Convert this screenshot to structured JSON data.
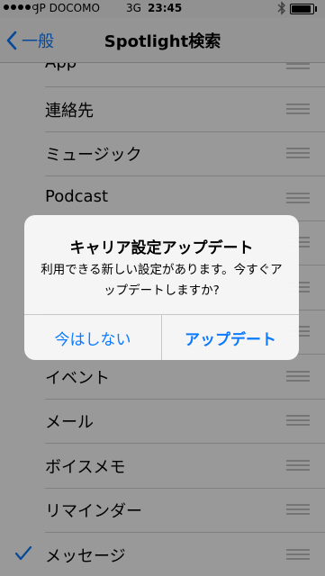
{
  "status_bar": {
    "carrier": "JP DOCOMO",
    "network": "3G",
    "time": "23:45",
    "signal_bars_filled": 4,
    "signal_bars_total": 5,
    "battery_level": 0.9,
    "icons": [
      "bluetooth-icon",
      "battery-icon"
    ]
  },
  "nav": {
    "back_label": "一般",
    "title": "Spotlight検索"
  },
  "list": {
    "items": [
      {
        "label": "App",
        "checked": false
      },
      {
        "label": "連絡先",
        "checked": false
      },
      {
        "label": "ミュージック",
        "checked": false
      },
      {
        "label": "Podcast",
        "checked": false
      },
      {
        "label": "",
        "checked": false
      },
      {
        "label": "",
        "checked": false
      },
      {
        "label": "",
        "checked": false
      },
      {
        "label": "イベント",
        "checked": false
      },
      {
        "label": "メール",
        "checked": false
      },
      {
        "label": "ボイスメモ",
        "checked": false
      },
      {
        "label": "リマインダー",
        "checked": false
      },
      {
        "label": "メッセージ",
        "checked": true
      }
    ]
  },
  "alert": {
    "title": "キャリア設定アップデート",
    "message": "利用できる新しい設定があります。今すぐアップデートしますか?",
    "cancel_label": "今はしない",
    "confirm_label": "アップデート"
  },
  "colors": {
    "accent": "#0a7aff",
    "overlay": "rgba(0,0,0,0.40)"
  }
}
